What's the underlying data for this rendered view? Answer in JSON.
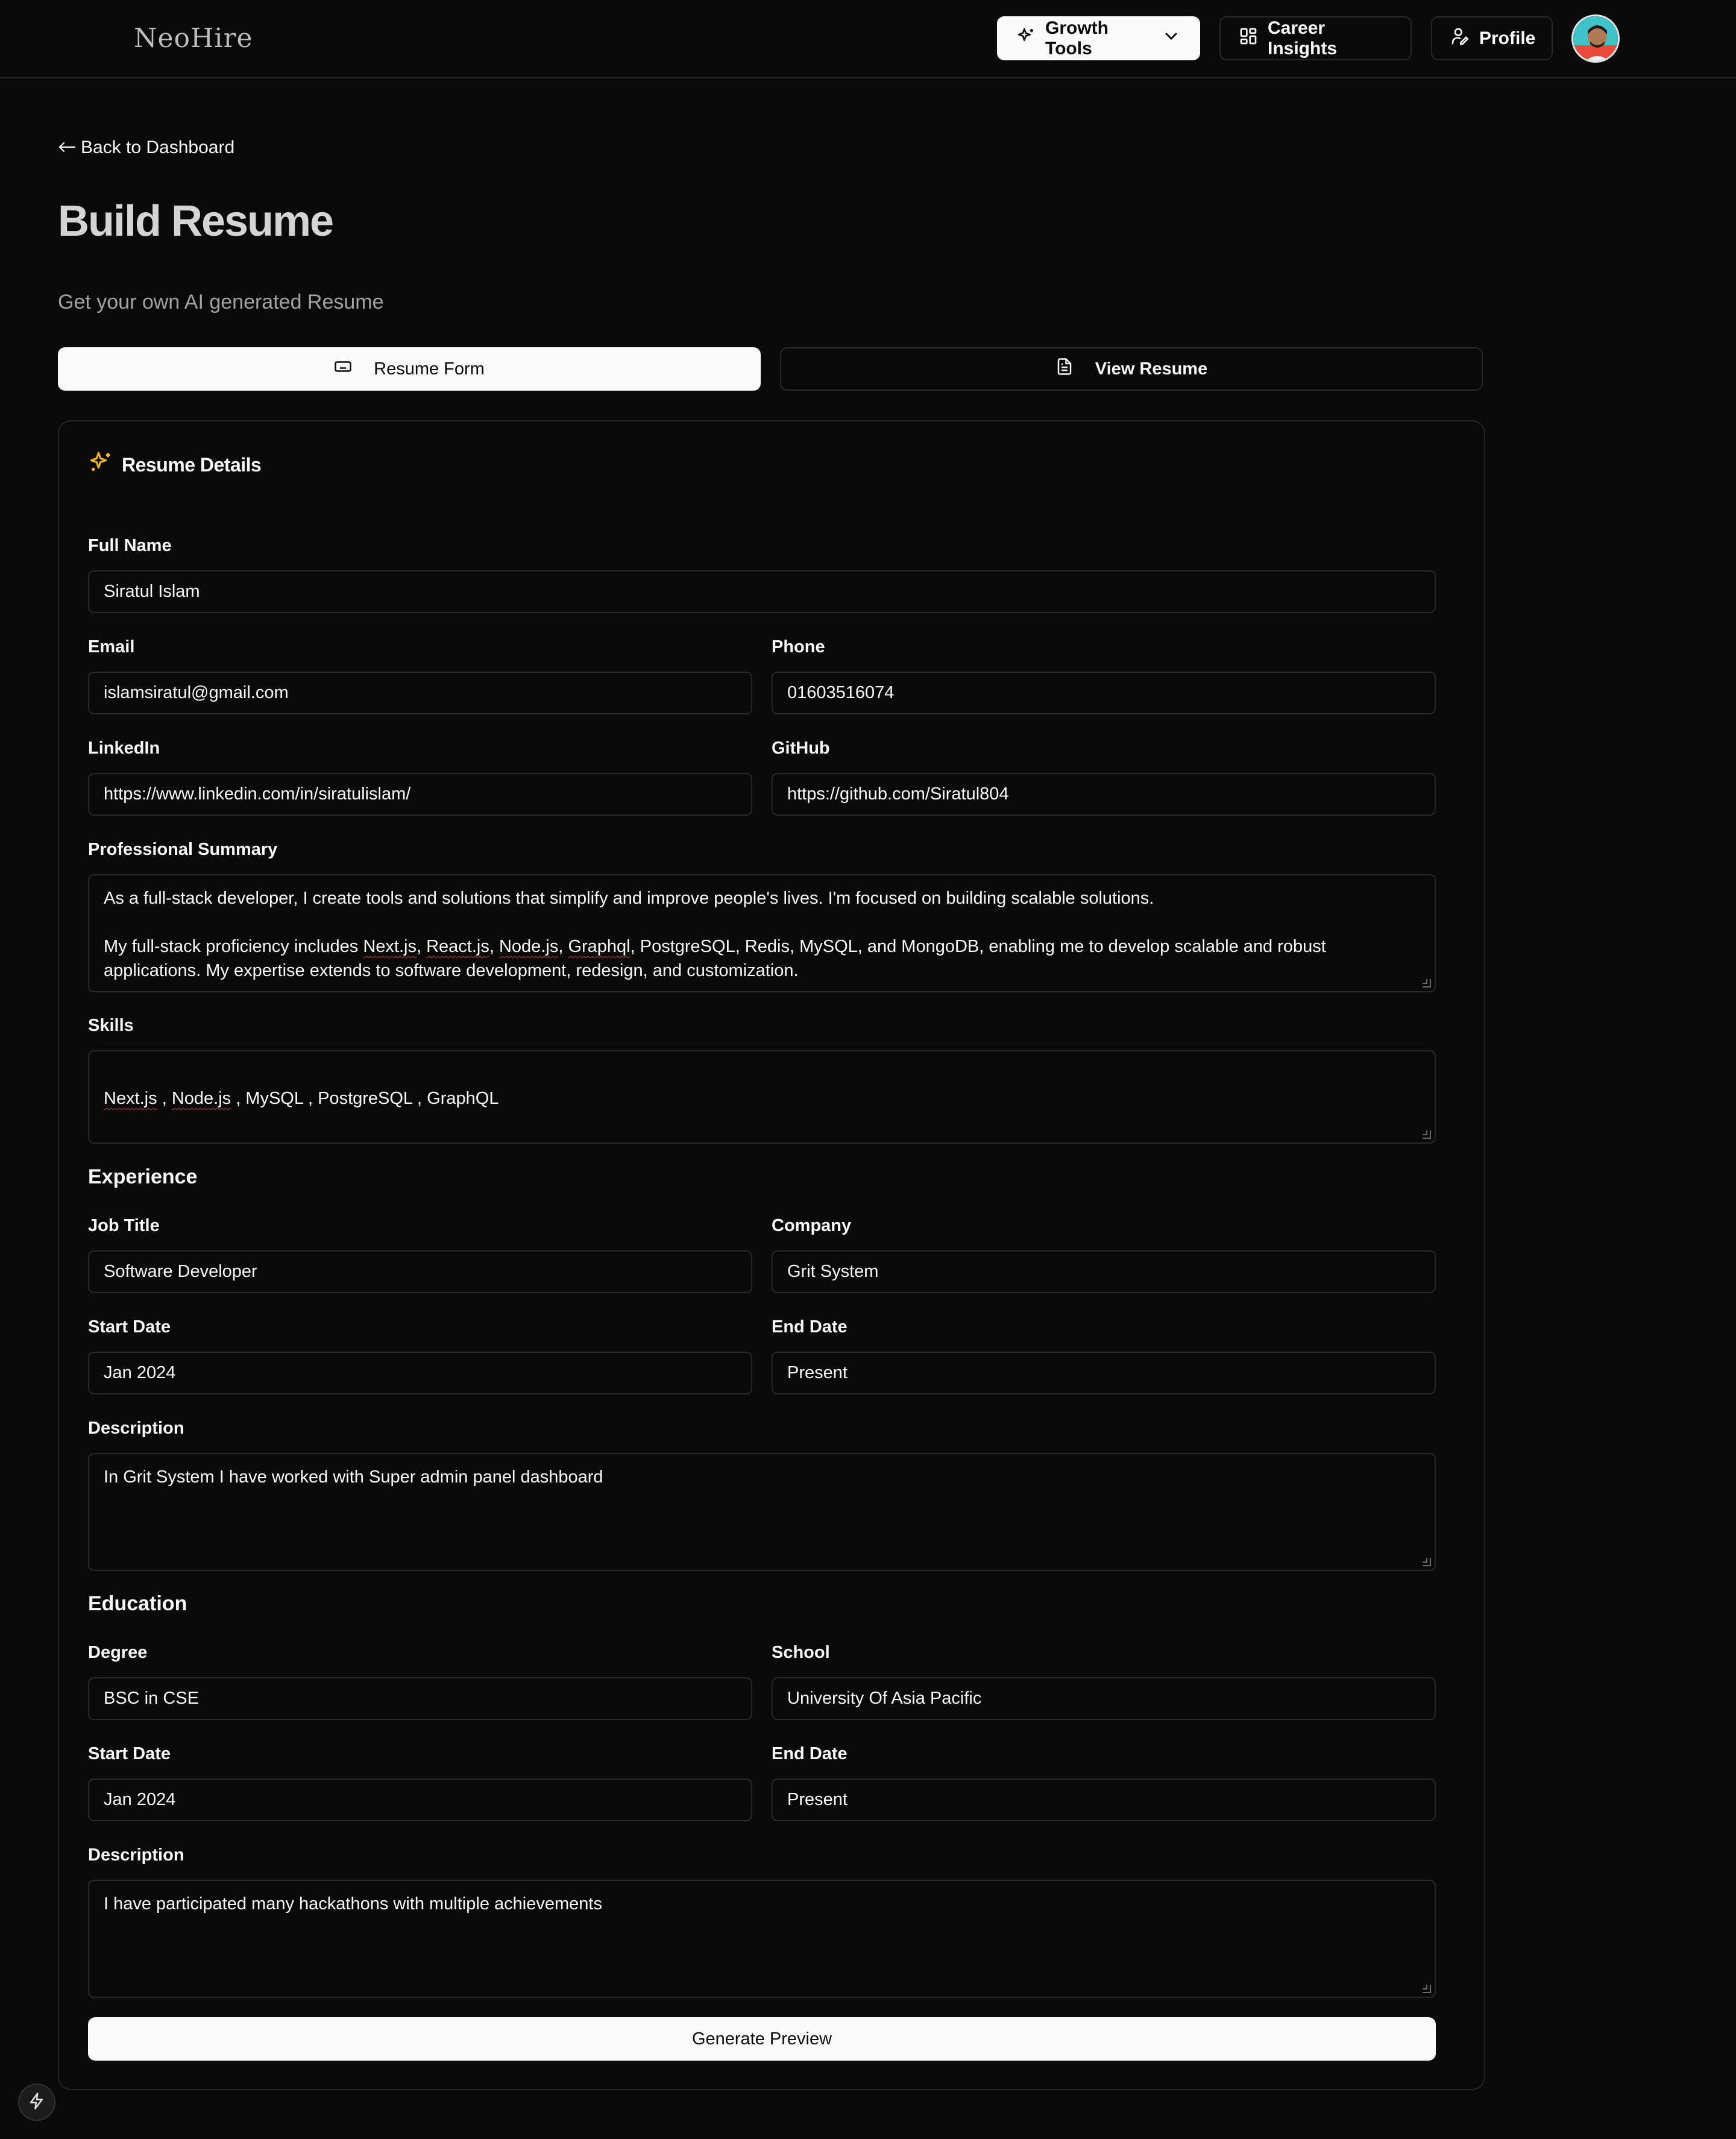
{
  "header": {
    "logo": "NeoHire",
    "nav": {
      "growth_tools": "Growth Tools",
      "career_insights": "Career Insights",
      "profile": "Profile"
    }
  },
  "page": {
    "back_link": "Back to Dashboard",
    "title": "Build Resume",
    "subtitle": "Get your own AI generated Resume"
  },
  "tabs": {
    "form": "Resume Form",
    "view": "View Resume"
  },
  "card": {
    "title": "Resume Details"
  },
  "form": {
    "full_name": {
      "label": "Full Name",
      "value": "Siratul Islam"
    },
    "email": {
      "label": "Email",
      "value": "islamsiratul@gmail.com"
    },
    "phone": {
      "label": "Phone",
      "value": "01603516074"
    },
    "linkedin": {
      "label": "LinkedIn",
      "value": "https://www.linkedin.com/in/siratulislam/"
    },
    "github": {
      "label": "GitHub",
      "value": "https://github.com/Siratul804"
    },
    "summary": {
      "label": "Professional Summary",
      "para1": "As a full-stack developer, I create tools and solutions that simplify and improve people's lives. I'm focused on building scalable solutions.",
      "para2_before": "My full-stack proficiency includes ",
      "para2_t1": "Next.js",
      "para2_t2": "React.js",
      "para2_t3": "Node.js",
      "para2_t4": "Graphql",
      "para2_after": ", PostgreSQL, Redis, MySQL, and MongoDB, enabling me to develop scalable and robust applications. My expertise extends to software development, redesign, and customization."
    },
    "skills": {
      "label": "Skills",
      "s1": "Next.js",
      "s2": "Node.js",
      "rest": " , MySQL , PostgreSQL , GraphQL"
    }
  },
  "experience": {
    "heading": "Experience",
    "job_title": {
      "label": "Job Title",
      "value": "Software Developer"
    },
    "company": {
      "label": "Company",
      "value": "Grit System"
    },
    "start_date": {
      "label": "Start Date",
      "value": "Jan 2024"
    },
    "end_date": {
      "label": "End Date",
      "value": "Present"
    },
    "description": {
      "label": "Description",
      "value": "In Grit System I have worked with Super admin panel dashboard"
    }
  },
  "education": {
    "heading": "Education",
    "degree": {
      "label": "Degree",
      "value": "BSC in CSE"
    },
    "school": {
      "label": "School",
      "value": "University Of Asia Pacific"
    },
    "start_date": {
      "label": "Start Date",
      "value": "Jan 2024"
    },
    "end_date": {
      "label": "End Date",
      "value": "Present"
    },
    "description": {
      "label": "Description",
      "value": "I have participated many hackathons with multiple achievements"
    }
  },
  "actions": {
    "generate": "Generate Preview"
  },
  "icons": {
    "growth": "sparkles-icon",
    "insights": "grid-icon",
    "profile": "user-pen-icon",
    "form_tab": "keyboard-icon",
    "view_tab": "file-text-icon",
    "card": "sparkles-icon",
    "fab": "bolt-icon"
  },
  "colors": {
    "background": "#0a0a0a",
    "accent_icon": "#f5b728",
    "primary_button": "#fafafa"
  }
}
